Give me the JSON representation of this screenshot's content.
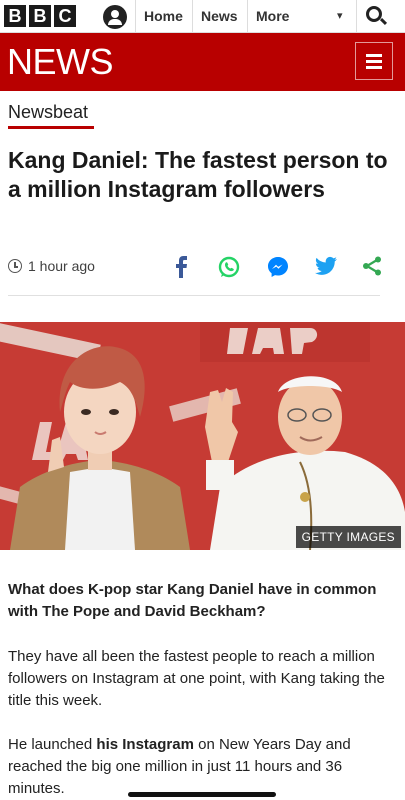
{
  "brand": {
    "letters": [
      "B",
      "B",
      "C"
    ]
  },
  "nav": {
    "home": "Home",
    "news": "News",
    "more": "More",
    "caret": "▾"
  },
  "banner": {
    "title": "NEWS"
  },
  "article": {
    "section": "Newsbeat",
    "headline": "Kang Daniel: The fastest person to a million Instagram followers",
    "time": "1 hour ago",
    "image_credit": "GETTY IMAGES",
    "intro": "What does K-pop star Kang Daniel have in common with The Pope and David Beckham?",
    "para1": "They have all been the fastest people to reach a million followers on Instagram at one point, with Kang taking the title this week.",
    "para2_pre": "He launched ",
    "para2_link": "his Instagram",
    "para2_post": " on New Years Day and reached the big one million in just 11 hours and 36 minutes."
  },
  "share_icons": [
    "facebook-icon",
    "whatsapp-icon",
    "messenger-icon",
    "twitter-icon",
    "share-icon"
  ],
  "colors": {
    "brand_red": "#b80000",
    "facebook": "#3b5998",
    "whatsapp": "#25d366",
    "messenger": "#0084ff",
    "twitter": "#1da1f2",
    "share": "#34a853"
  }
}
